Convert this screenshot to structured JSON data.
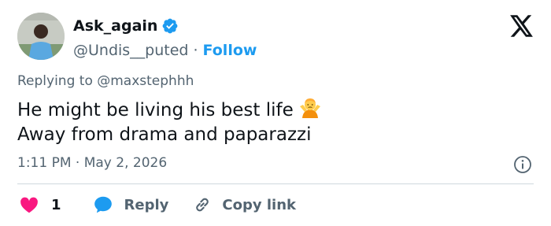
{
  "author": {
    "display_name": "Ask_again",
    "handle": "@Undis__puted",
    "separator": "·",
    "follow_label": "Follow",
    "verified_color": "#1d9bf0"
  },
  "tweet": {
    "replying_to": "Replying to @maxstephhh",
    "lines": [
      "He might be living his best life",
      "Away from drama and paparazzi"
    ],
    "emoji": "person-shrugging-emoji",
    "timestamp": "1:11 PM · May 2, 2026"
  },
  "actions": {
    "like_count": "1",
    "reply_label": "Reply",
    "copy_label": "Copy link"
  },
  "colors": {
    "accent": "#1d9bf0",
    "heart": "#f91880",
    "muted": "#536471",
    "text": "#0f1419"
  }
}
